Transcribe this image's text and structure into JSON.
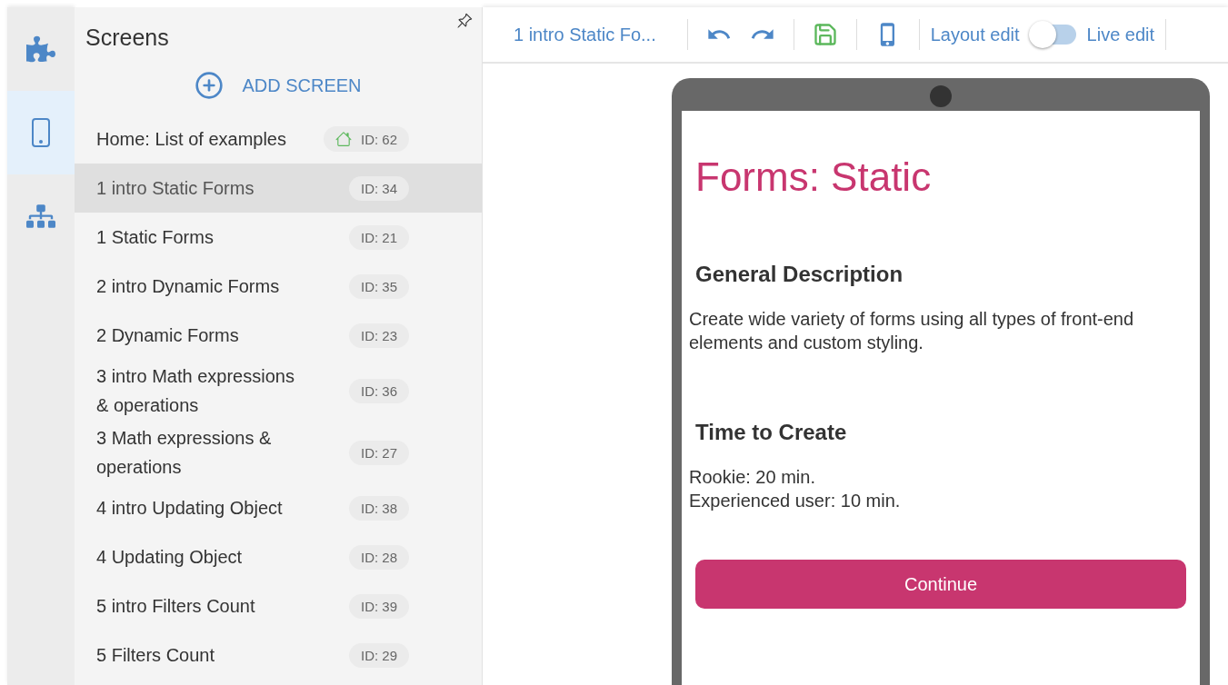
{
  "rail": [
    {
      "kind": "puzzle",
      "selected": false
    },
    {
      "kind": "phone",
      "selected": true
    },
    {
      "kind": "sitemap",
      "selected": false
    }
  ],
  "sidebar": {
    "title": "Screens",
    "add_button": "ADD SCREEN",
    "screens": [
      {
        "name": "Home: List of examples",
        "id": "ID: 62",
        "home": true,
        "selected": false
      },
      {
        "name": "1 intro Static Forms",
        "id": "ID: 34",
        "home": false,
        "selected": true
      },
      {
        "name": "1 Static Forms",
        "id": "ID: 21",
        "home": false,
        "selected": false
      },
      {
        "name": "2 intro Dynamic Forms",
        "id": "ID: 35",
        "home": false,
        "selected": false
      },
      {
        "name": "2 Dynamic Forms",
        "id": "ID: 23",
        "home": false,
        "selected": false
      },
      {
        "name": "3 intro Math expressions & operations",
        "id": "ID: 36",
        "home": false,
        "selected": false
      },
      {
        "name": "3 Math expressions & operations",
        "id": "ID: 27",
        "home": false,
        "selected": false
      },
      {
        "name": "4 intro Updating Object",
        "id": "ID: 38",
        "home": false,
        "selected": false
      },
      {
        "name": "4 Updating Object",
        "id": "ID: 28",
        "home": false,
        "selected": false
      },
      {
        "name": "5 intro Filters Count",
        "id": "ID: 39",
        "home": false,
        "selected": false
      },
      {
        "name": "5 Filters Count",
        "id": "ID: 29",
        "home": false,
        "selected": false
      }
    ]
  },
  "toolbar": {
    "screen_title": "1 intro Static Fo...",
    "layout_label": "Layout edit",
    "live_edit_on": false,
    "live_label": "Live edit"
  },
  "phone": {
    "title": "Forms: Static",
    "sections": [
      {
        "heading": "General Description",
        "lines": [
          "Create wide variety of forms using all types of front-end elements and custom styling."
        ]
      },
      {
        "heading": "Time to Create",
        "lines": [
          "Rookie: 20 min.",
          "Experienced user: 10 min."
        ]
      }
    ],
    "button": "Continue"
  }
}
